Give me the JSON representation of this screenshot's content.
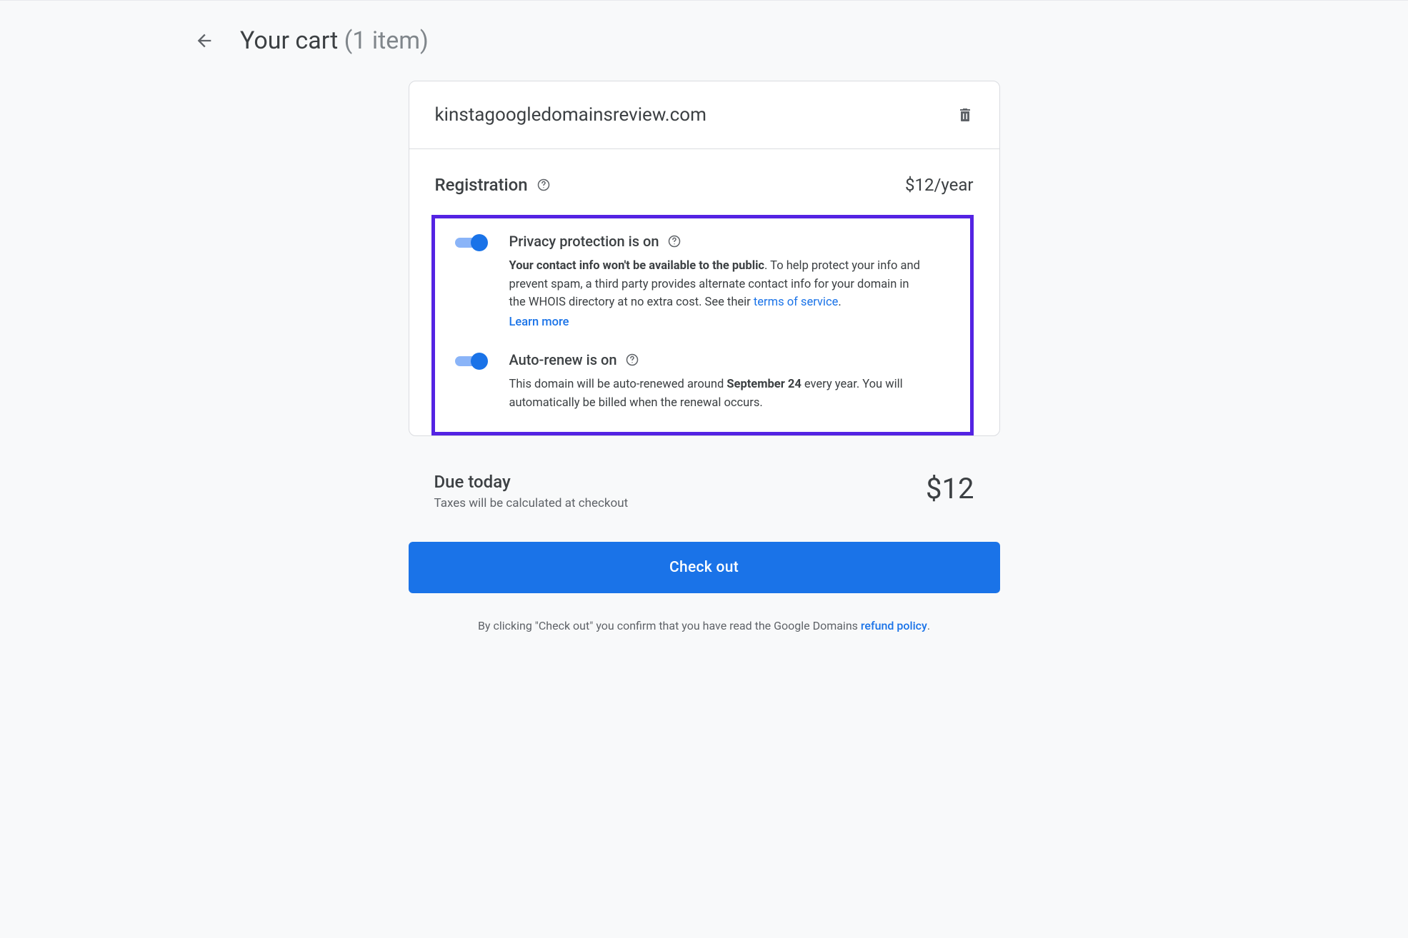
{
  "header": {
    "title": "Your cart",
    "count_label": "(1 item)"
  },
  "cart": {
    "domain": "kinstagoogledomainsreview.com",
    "registration_label": "Registration",
    "price_label": "$12/year",
    "privacy": {
      "title": "Privacy protection is on",
      "desc_bold": "Your contact info won't be available to the public",
      "desc_rest": ". To help protect your info and prevent spam, a third party provides alternate contact info for your domain in the WHOIS directory at no extra cost. See their ",
      "tos_link": "terms of service",
      "period": ".",
      "learn_more": "Learn more"
    },
    "autorenew": {
      "title": "Auto-renew is on",
      "desc_pre": "This domain will be auto-renewed around ",
      "date": "September 24",
      "desc_post": " every year. You will automatically be billed when the renewal occurs."
    }
  },
  "due": {
    "title": "Due today",
    "subtitle": "Taxes will be calculated at checkout",
    "amount": "$12"
  },
  "checkout_label": "Check out",
  "footer": {
    "text": "By clicking \"Check out\" you confirm that you have read the Google Domains ",
    "link": "refund policy",
    "period": "."
  }
}
